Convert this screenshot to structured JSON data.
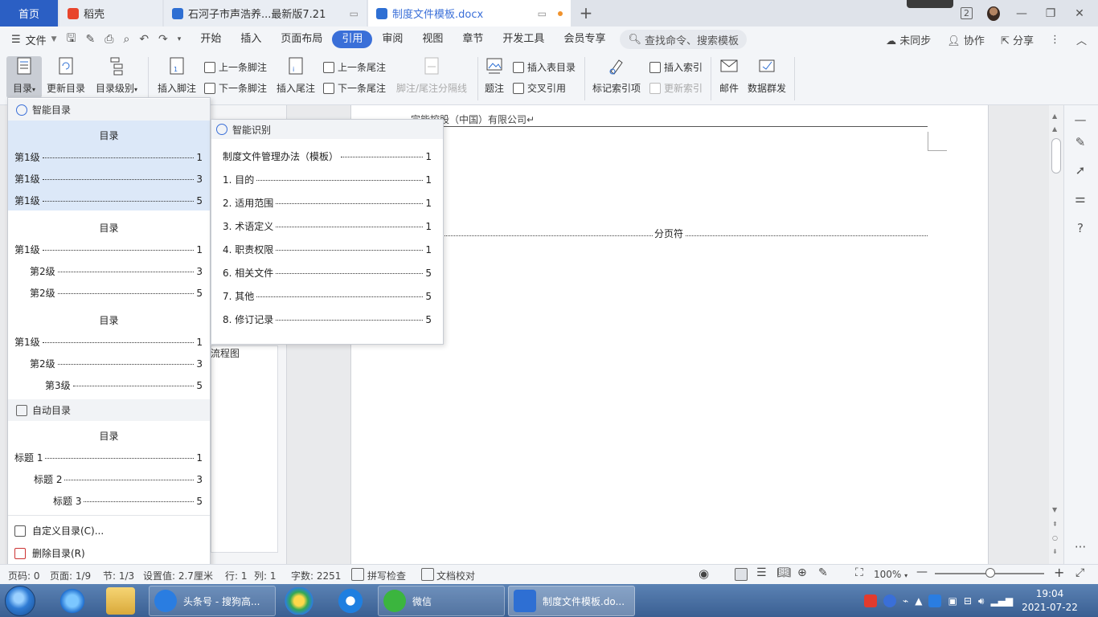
{
  "tabs": {
    "home": "首页",
    "daoke": "稻壳",
    "doc1": "石河子市声浩养...最新版7.21",
    "doc2": "制度文件模板.docx",
    "new_tab": "+"
  },
  "titlebar": {
    "badge": "2"
  },
  "menubar": {
    "file": "文件",
    "items": [
      "开始",
      "插入",
      "页面布局",
      "引用",
      "审阅",
      "视图",
      "章节",
      "开发工具",
      "会员专享"
    ],
    "active": "引用",
    "search_placeholder": "查找命令、搜索模板",
    "right": [
      "未同步",
      "协作",
      "分享"
    ]
  },
  "ribbon": {
    "toc": "目录",
    "update_toc": "更新目录",
    "toc_level": "目录级别",
    "insert_footnote": "插入脚注",
    "prev_footnote": "上一条脚注",
    "next_footnote": "下一条脚注",
    "insert_endnote": "插入尾注",
    "prev_endnote": "上一条尾注",
    "next_endnote": "下一条尾注",
    "note_separator": "脚注/尾注分隔线",
    "caption": "题注",
    "insert_table_of_figures": "插入表目录",
    "cross_reference": "交叉引用",
    "mark_index_entry": "标记索引项",
    "insert_index": "插入索引",
    "update_index": "更新索引",
    "mail": "邮件",
    "data_mass_send": "数据群发"
  },
  "toc_panel": {
    "smart_head": "智能目录",
    "auto_head": "自动目录",
    "blocks": [
      {
        "title": "目录",
        "rows": [
          {
            "label": "第1级",
            "page": "1"
          },
          {
            "label": "第1级",
            "page": "3"
          },
          {
            "label": "第1级",
            "page": "5"
          }
        ]
      },
      {
        "title": "目录",
        "rows": [
          {
            "label": "第1级",
            "page": "1"
          },
          {
            "label": "第2级",
            "page": "3"
          },
          {
            "label": "第2级",
            "page": "5"
          }
        ]
      },
      {
        "title": "目录",
        "rows": [
          {
            "label": "第1级",
            "page": "1"
          },
          {
            "label": "第2级",
            "page": "3"
          },
          {
            "label": "第3级",
            "page": "5"
          }
        ]
      },
      {
        "title": "目录",
        "rows": [
          {
            "label": "标题 1",
            "page": "1"
          },
          {
            "label": "标题 2",
            "page": "3"
          },
          {
            "label": "标题 3",
            "page": "5"
          }
        ]
      }
    ],
    "custom": "自定义目录(C)...",
    "delete": "删除目录(R)"
  },
  "smart_panel": {
    "head": "智能识别",
    "rows": [
      {
        "label": "制度文件管理办法（模板）",
        "page": "1"
      },
      {
        "label": "1. 目的",
        "page": "1"
      },
      {
        "label": "2. 适用范围",
        "page": "1"
      },
      {
        "label": "3. 术语定义",
        "page": "1"
      },
      {
        "label": "4. 职责权限",
        "page": "1"
      },
      {
        "label": "6. 相关文件",
        "page": "5"
      },
      {
        "label": "7. 其他",
        "page": "5"
      },
      {
        "label": "8. 修订记录",
        "page": "5"
      }
    ]
  },
  "document": {
    "header_text": "宗能控股（中国）有限公司↵",
    "page_break": "分页符",
    "nav_text": "流程图"
  },
  "statusbar": {
    "page_no": "页码: 0",
    "pages": "页面: 1/9",
    "section": "节: 1/3",
    "setting": "设置值: 2.7厘米",
    "row": "行: 1",
    "col": "列: 1",
    "words": "字数: 2251",
    "spell": "拼写检查",
    "proof": "文档校对",
    "zoom": "100%"
  },
  "taskbar": {
    "task1": "头条号 - 搜狗高...",
    "task2": "微信",
    "task3": "制度文件模板.do...",
    "time": "19:04",
    "date": "2021-07-22"
  }
}
